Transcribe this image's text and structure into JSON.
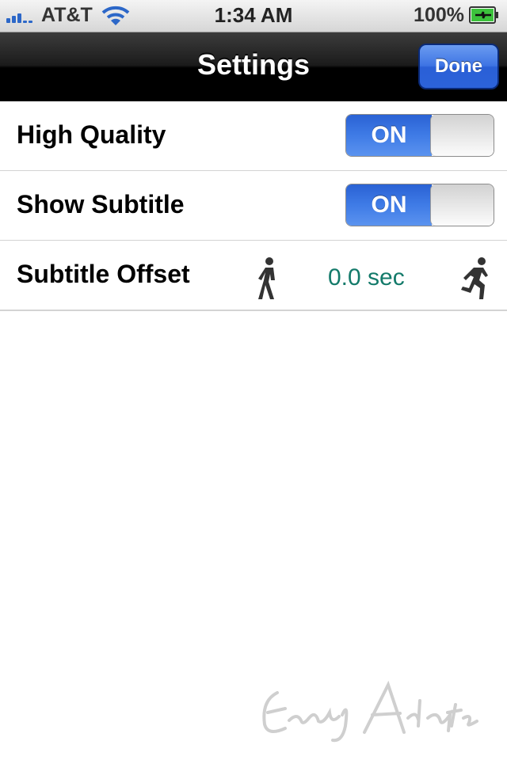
{
  "status_bar": {
    "carrier": "AT&T",
    "time": "1:34 AM",
    "battery_percent": "100%",
    "icons": [
      "signal-icon",
      "wifi-icon",
      "battery-charging-icon"
    ]
  },
  "nav": {
    "title": "Settings",
    "done_label": "Done"
  },
  "settings": {
    "high_quality": {
      "label": "High Quality",
      "switch_text": "ON",
      "value": true
    },
    "show_subtitle": {
      "label": "Show Subtitle",
      "switch_text": "ON",
      "value": true
    },
    "subtitle_offset": {
      "label": "Subtitle Offset",
      "value": "0.0 sec",
      "decrease_icon": "walk-icon",
      "increase_icon": "run-icon"
    }
  },
  "watermark": {
    "text": "Early Adopter"
  },
  "colors": {
    "switch_on": "#3f7be6",
    "offset_value": "#137a6a",
    "done_button": "#3e74e4"
  }
}
